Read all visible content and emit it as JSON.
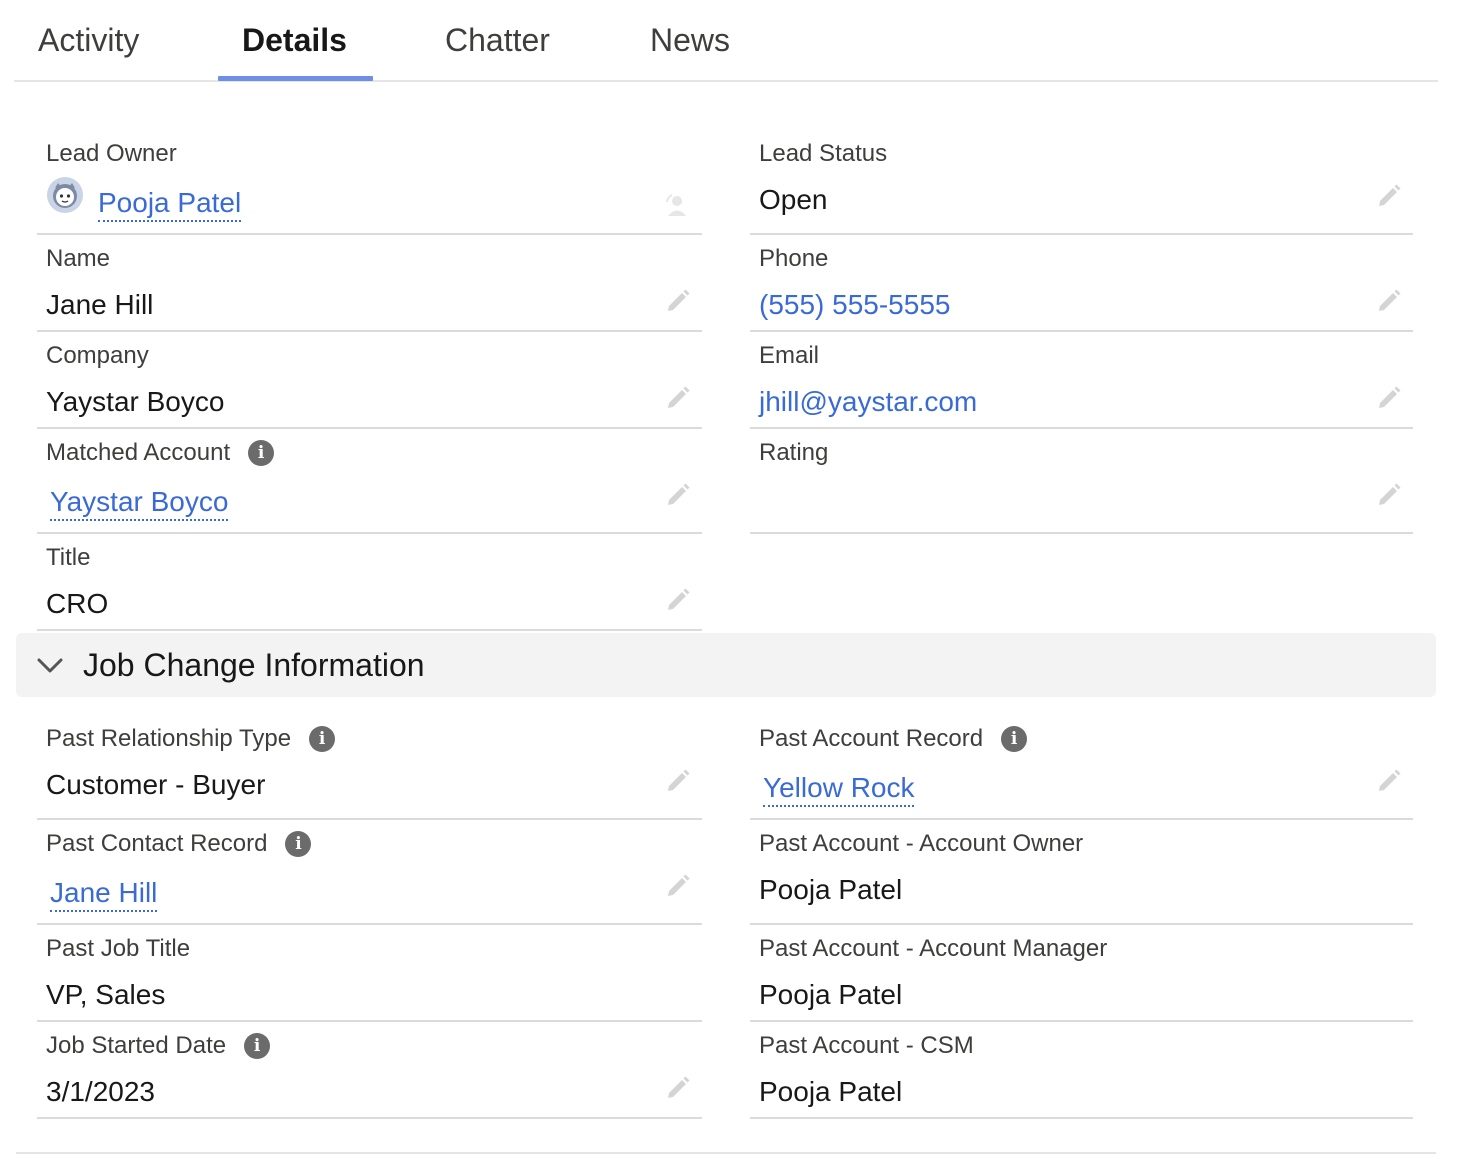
{
  "tabs": {
    "activity": "Activity",
    "details": "Details",
    "chatter": "Chatter",
    "news": "News"
  },
  "details": {
    "lead_owner": {
      "label": "Lead Owner",
      "value": "Pooja Patel"
    },
    "lead_status": {
      "label": "Lead Status",
      "value": "Open"
    },
    "name": {
      "label": "Name",
      "value": "Jane Hill"
    },
    "phone": {
      "label": "Phone",
      "value": "(555) 555-5555"
    },
    "company": {
      "label": "Company",
      "value": "Yaystar Boyco"
    },
    "email": {
      "label": "Email",
      "value": "jhill@yaystar.com"
    },
    "matched_account": {
      "label": "Matched Account",
      "value": "Yaystar Boyco"
    },
    "rating": {
      "label": "Rating",
      "value": ""
    },
    "title": {
      "label": "Title",
      "value": "CRO"
    }
  },
  "job_change": {
    "section_title": "Job Change Information",
    "past_relationship_type": {
      "label": "Past Relationship Type",
      "value": "Customer - Buyer"
    },
    "past_account_record": {
      "label": "Past Account Record",
      "value": "Yellow Rock"
    },
    "past_contact_record": {
      "label": "Past Contact Record",
      "value": "Jane Hill"
    },
    "past_account_owner": {
      "label": "Past Account - Account Owner",
      "value": "Pooja Patel"
    },
    "past_job_title": {
      "label": "Past Job Title",
      "value": "VP, Sales"
    },
    "past_account_manager": {
      "label": "Past Account - Account Manager",
      "value": "Pooja Patel"
    },
    "job_started_date": {
      "label": "Job Started Date",
      "value": "3/1/2023"
    },
    "past_account_csm": {
      "label": "Past Account - CSM",
      "value": "Pooja Patel"
    }
  },
  "icons": {
    "info": "info-icon",
    "edit": "pencil-icon",
    "collapse": "chevron-down-icon",
    "avatar": "avatar-icon",
    "change_owner": "change-owner-icon"
  },
  "colors": {
    "accent": "#6f8fe6",
    "link": "#3a6ad6",
    "divider": "#dddbda",
    "section_bg": "#f3f3f3"
  }
}
